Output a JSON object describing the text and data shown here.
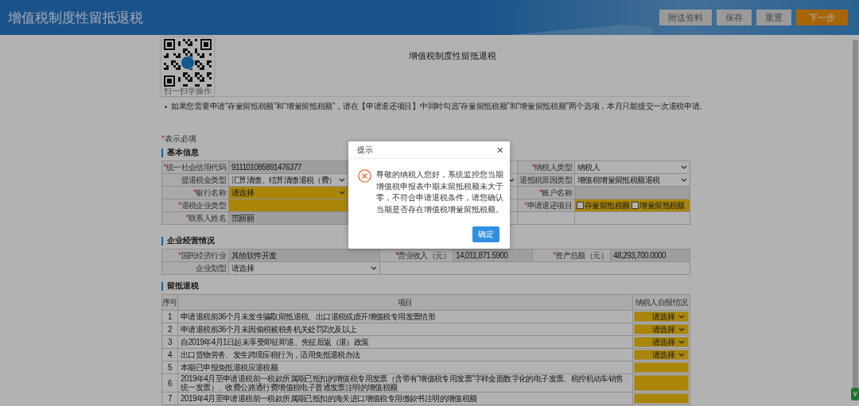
{
  "header": {
    "title": "增值税制度性留抵退税",
    "buttons": [
      {
        "label": "附送资料",
        "kind": "secondary"
      },
      {
        "label": "保存",
        "kind": "secondary"
      },
      {
        "label": "重置",
        "kind": "secondary"
      },
      {
        "label": "下一步",
        "kind": "primary"
      }
    ]
  },
  "qr": {
    "caption": "扫一扫学操作"
  },
  "page_title": "增值税制度性留抵退税",
  "notes": [
    "如果您需要申请“存量留抵税额”和“增量留抵税额”，请在【申请退还项目】中同时勾选“存量留抵税额”和“增量留抵税额”两个选项，本月只能提交一次退税申请。"
  ],
  "required_mark": "*",
  "required_legend": "表示必填",
  "basic_info": {
    "title": "基本信息",
    "rows": [
      {
        "left": {
          "label": "统一社会信用代码",
          "required": true,
          "field": {
            "kind": "text",
            "value": "911101085891476377",
            "readonly": true,
            "highlighted": false
          }
        },
        "middle": {
          "kind": "blank"
        },
        "right": {
          "label": "纳税人类型",
          "required": true,
          "field": {
            "kind": "select",
            "value": "纳税人",
            "highlighted": false
          }
        }
      },
      {
        "left": {
          "label": "提退税金类型",
          "required": false,
          "field": {
            "kind": "select",
            "value": "汇算清缴、结算清缴退税（费）",
            "highlighted": false
          }
        },
        "middle": {
          "kind": "select"
        },
        "right": {
          "label": "退抵税原因类型",
          "required": false,
          "field": {
            "kind": "select",
            "value": "增值税增量留抵税额退税",
            "highlighted": false
          }
        }
      },
      {
        "left": {
          "label": "银行名称",
          "required": true,
          "field": {
            "kind": "select",
            "value": "请选择",
            "highlighted": true
          }
        },
        "middle": {
          "kind": "blank"
        },
        "right": {
          "label": "账户名称",
          "required": true,
          "field": {
            "kind": "text",
            "readonly": true,
            "highlighted": false
          }
        }
      },
      {
        "left": {
          "label": "退税企业类型",
          "required": true,
          "field": {
            "kind": "text",
            "readonly": false,
            "highlighted": true
          }
        },
        "middle": {
          "kind": "blank"
        },
        "right": {
          "label": "申请退还项目",
          "required": true,
          "field": {
            "kind": "checkboxes",
            "highlighted": true,
            "options": [
              {
                "label": "存量留抵税额",
                "checked": false
              },
              {
                "label": "增量留抵税额",
                "checked": false
              }
            ]
          }
        }
      },
      {
        "left": {
          "label": "联系人姓名",
          "required": true,
          "field": {
            "kind": "text",
            "value": "范丽丽",
            "readonly": true,
            "highlighted": false
          }
        },
        "middle": {
          "kind": "blank"
        },
        "right": {
          "kind": "blank"
        }
      }
    ]
  },
  "business": {
    "title": "企业经营情况",
    "rows": [
      {
        "pairs": [
          {
            "label": "国民经济行业",
            "required": true,
            "field": {
              "kind": "text",
              "value": "其他软件开发",
              "readonly": true,
              "highlighted": false
            }
          },
          {
            "label": "营业收入（元）",
            "required": true,
            "field": {
              "kind": "text",
              "value": "14,011,871.5900",
              "readonly": true,
              "highlighted": false
            }
          },
          {
            "label": "资产总额（元）",
            "required": true,
            "field": {
              "kind": "text",
              "value": "48,293,700.0000",
              "readonly": true,
              "highlighted": false
            }
          }
        ]
      },
      {
        "pairs": [
          {
            "label": "企业划型",
            "required": false,
            "field": {
              "kind": "select",
              "value": "请选择",
              "highlighted": false
            }
          }
        ]
      }
    ]
  },
  "refund": {
    "title": "留抵退税",
    "columns": [
      "序号",
      "项目",
      "纳税人自报情况"
    ],
    "rows": [
      {
        "no": "1",
        "item": "申请退税前36个月未发生骗取留抵退税、出口退税或虚开增值税专用发票情形",
        "answer": {
          "kind": "select",
          "value": "请选择"
        }
      },
      {
        "no": "2",
        "item": "申请退税前36个月未因偷税被税务机关处罚2次及以上",
        "answer": {
          "kind": "select",
          "value": "请选择"
        }
      },
      {
        "no": "3",
        "item": "自2019年4月1日起未享受即征即退、先征后返（退）政策",
        "answer": {
          "kind": "select",
          "value": "请选择"
        }
      },
      {
        "no": "4",
        "item": "出口货物劳务、发生跨境应税行为，适用免抵退税办法",
        "answer": {
          "kind": "select",
          "value": "请选择"
        }
      },
      {
        "no": "5",
        "item": "本期已申报免抵退税应退税额",
        "answer": {
          "kind": "input"
        }
      },
      {
        "no": "6",
        "item": "2019年4月至申请退税前一税款所属期已抵扣的增值税专用发票（含带有“增值税专用发票”字样全面数字化的电子发票、税控机动车销售统一发票）、收费公路通行费增值税电子普通发票注明的增值税额",
        "answer": {
          "kind": "input"
        }
      },
      {
        "no": "7",
        "item": "2019年4月至申请退税前一税款所属期已抵扣的海关进口增值税专用缴款书注明的增值税额",
        "answer": {
          "kind": "input"
        }
      }
    ]
  },
  "dialog": {
    "title": "提示",
    "close": "×",
    "message": "尊敬的纳税人您好，系统监控您当期增值税申报表中期末留抵税额未大于零，不符合申请退税条件，请您确认当期是否存在增值税增量留抵税额。",
    "confirm": "确定"
  }
}
